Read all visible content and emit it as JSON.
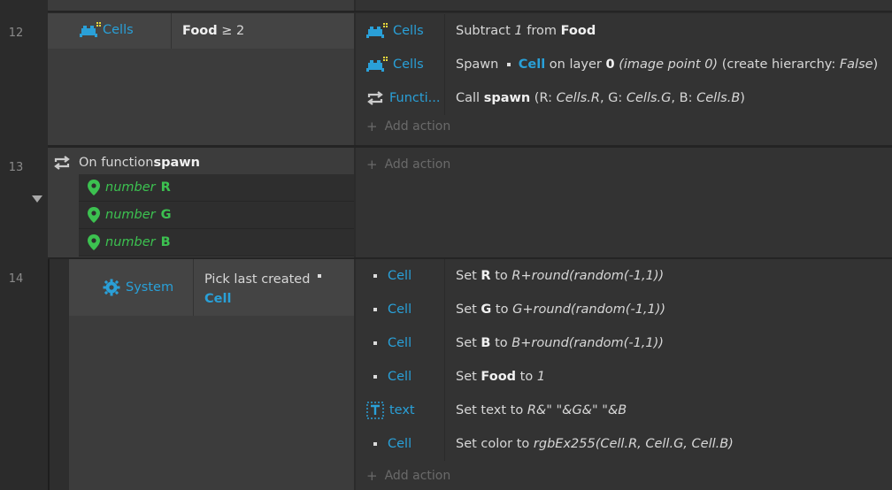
{
  "add_action_label": "Add action",
  "events": [
    {
      "number": "12",
      "condition": {
        "object": "Cells",
        "text_prefix": "Food",
        "text_suffix": " ≥ 2"
      },
      "actions": [
        {
          "object": "Cells",
          "icon": "sprite-icon",
          "parts": [
            {
              "t": "Subtract "
            },
            {
              "i": "1"
            },
            {
              "t": " from "
            },
            {
              "b": "Food"
            }
          ]
        },
        {
          "object": "Cells",
          "icon": "sprite-icon",
          "parts": [
            {
              "t": "Spawn  "
            },
            {
              "dot": "."
            },
            {
              "t": "  "
            },
            {
              "o": "Cell"
            },
            {
              "t": " on layer "
            },
            {
              "b": "0"
            },
            {
              "t": " "
            },
            {
              "i": "(image point 0)"
            },
            {
              "t": " (create hierarchy: "
            },
            {
              "i": "False"
            },
            {
              "t": ")"
            }
          ]
        },
        {
          "object": "Functi...",
          "icon": "function-icon",
          "parts": [
            {
              "t": "Call "
            },
            {
              "b": "spawn"
            },
            {
              "t": " (R: "
            },
            {
              "i": "Cells.R"
            },
            {
              "t": ", G: "
            },
            {
              "i": "Cells.G"
            },
            {
              "t": ", B: "
            },
            {
              "i": "Cells.B"
            },
            {
              "t": ")"
            }
          ]
        }
      ]
    },
    {
      "number": "13",
      "function": {
        "prefix": "On function ",
        "name": "spawn"
      },
      "params": [
        {
          "type": "number",
          "name": "R"
        },
        {
          "type": "number",
          "name": "G"
        },
        {
          "type": "number",
          "name": "B"
        }
      ]
    },
    {
      "number": "14",
      "condition": {
        "object": "System",
        "text": "Pick last created",
        "picked": "Cell"
      },
      "actions": [
        {
          "object": "Cell",
          "icon": "dot",
          "parts": [
            {
              "t": "Set "
            },
            {
              "b": "R"
            },
            {
              "t": " to "
            },
            {
              "i": "R+round(random(-1,1))"
            }
          ]
        },
        {
          "object": "Cell",
          "icon": "dot",
          "parts": [
            {
              "t": "Set "
            },
            {
              "b": "G"
            },
            {
              "t": " to "
            },
            {
              "i": "G+round(random(-1,1))"
            }
          ]
        },
        {
          "object": "Cell",
          "icon": "dot",
          "parts": [
            {
              "t": "Set "
            },
            {
              "b": "B"
            },
            {
              "t": " to "
            },
            {
              "i": "B+round(random(-1,1))"
            }
          ]
        },
        {
          "object": "Cell",
          "icon": "dot",
          "parts": [
            {
              "t": "Set "
            },
            {
              "b": "Food"
            },
            {
              "t": " to "
            },
            {
              "i": "1"
            }
          ]
        },
        {
          "object": "text",
          "icon": "text-icon",
          "parts": [
            {
              "t": "Set text to "
            },
            {
              "i": "R&\" \"&G&\" \"&B"
            }
          ]
        },
        {
          "object": "Cell",
          "icon": "dot",
          "parts": [
            {
              "t": "Set color to "
            },
            {
              "i": "rgbEx255(Cell.R, Cell.G, Cell.B)"
            }
          ]
        }
      ]
    }
  ],
  "colors": {
    "object_blue": "#29a0d8",
    "param_green": "#3cc150",
    "background": "#2b2b2b"
  }
}
